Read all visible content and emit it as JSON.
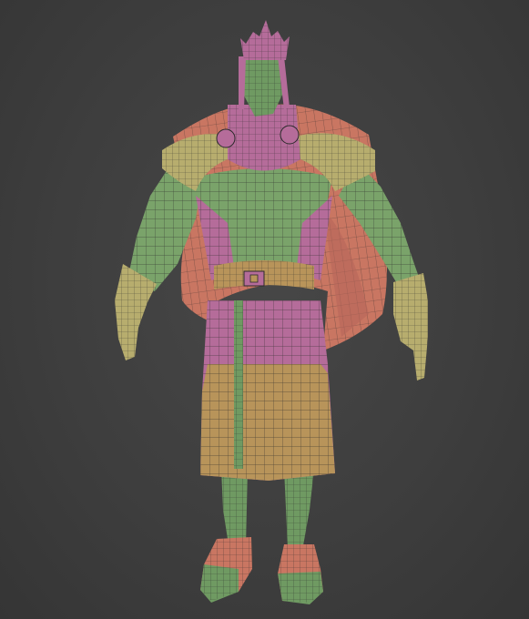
{
  "viewport": {
    "background": "#3e3e3e",
    "wire_color": "#2a2a2a"
  },
  "model": {
    "materials": {
      "skin_green": "#6f9a62",
      "armor_green": "#7aa36a",
      "cloth_pink": "#b56c9a",
      "cape_salmon": "#c97662",
      "cloth_tan": "#b8945a",
      "glove_tan": "#b7ad6e"
    }
  }
}
